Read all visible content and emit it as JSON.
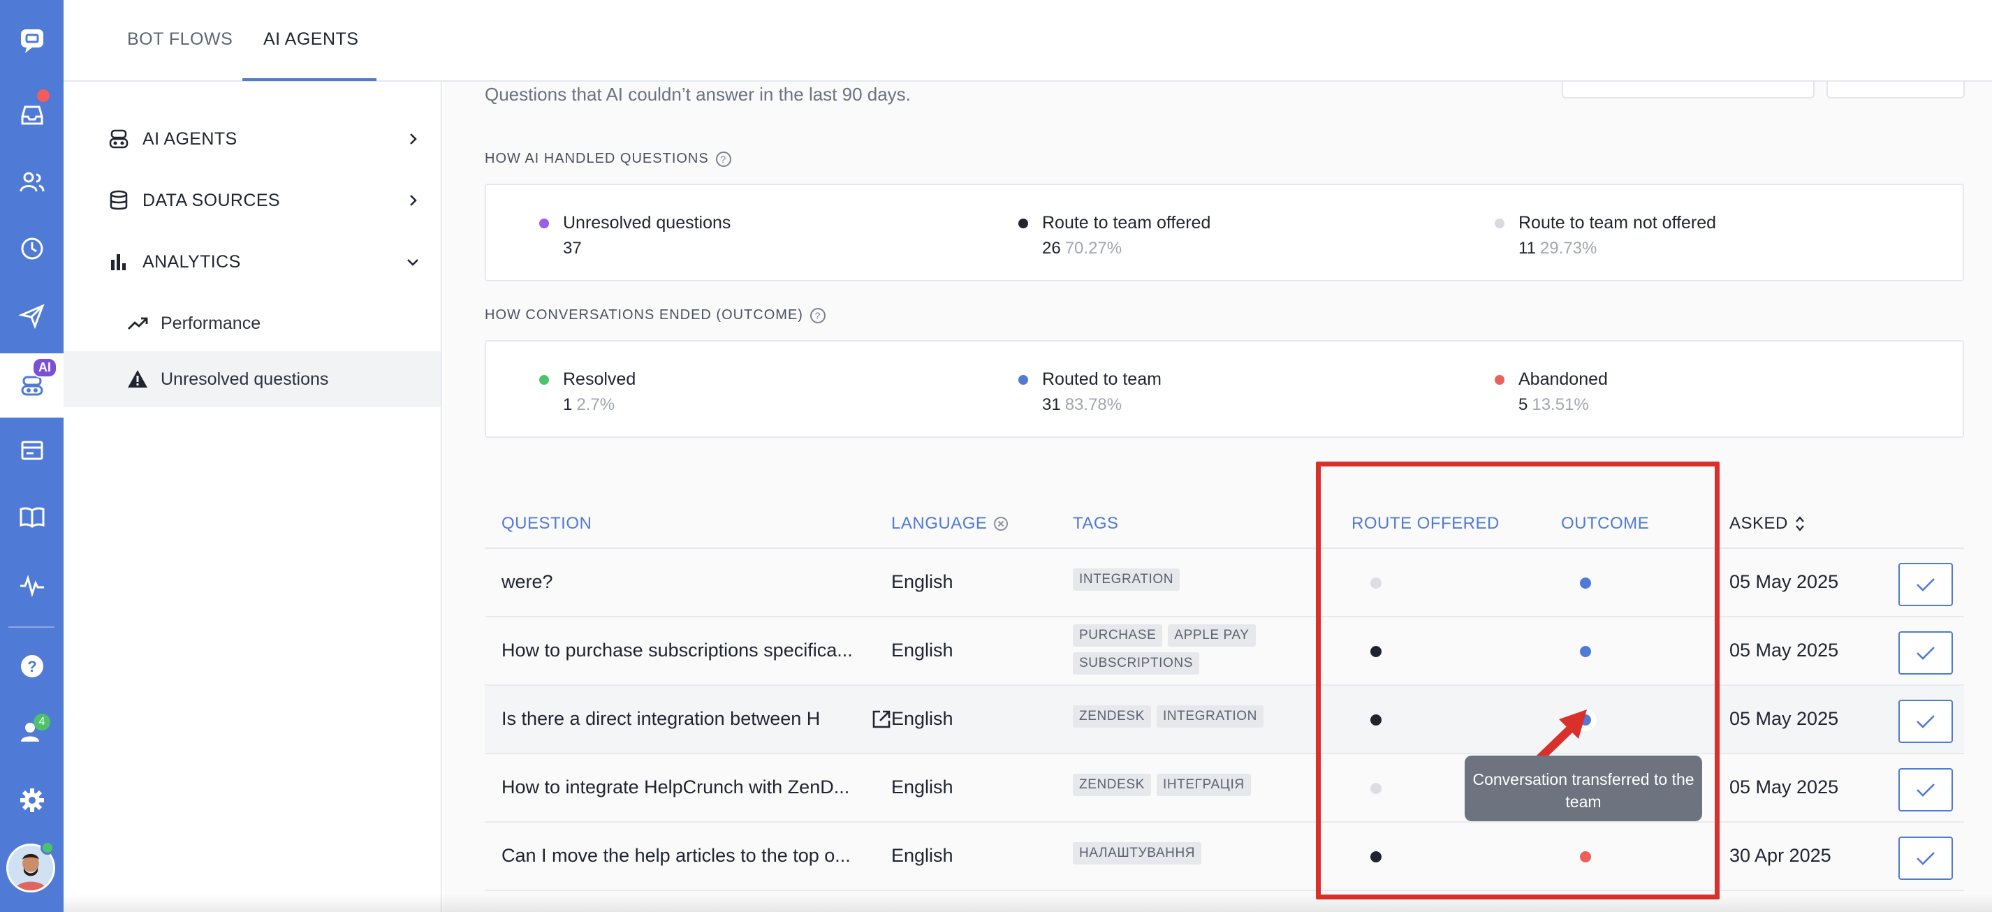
{
  "top_tabs": [
    {
      "label": "BOT FLOWS"
    },
    {
      "label": "AI AGENTS"
    }
  ],
  "sidebar": {
    "items": [
      {
        "label": "AI AGENTS",
        "icon": "robot-icon"
      },
      {
        "label": "DATA SOURCES",
        "icon": "database-icon"
      },
      {
        "label": "ANALYTICS",
        "icon": "bar-chart-icon"
      },
      {
        "label": "Performance",
        "icon": "trend-up-icon"
      },
      {
        "label": "Unresolved questions",
        "icon": "warning-icon"
      }
    ]
  },
  "rail": {
    "ai_badge": "AI",
    "team_badge": "4"
  },
  "main": {
    "subtitle": "Questions that AI couldn’t answer in the last 90 days.",
    "handled": {
      "label": "HOW AI HANDLED QUESTIONS",
      "stats": [
        {
          "name": "Unresolved questions",
          "value": "37",
          "pct": "",
          "color": "#9b5de5"
        },
        {
          "name": "Route to team offered",
          "value": "26",
          "pct": "70.27%",
          "color": "#1f2430"
        },
        {
          "name": "Route to team not offered",
          "value": "11",
          "pct": "29.73%",
          "color": "#d8dadf"
        }
      ]
    },
    "outcome": {
      "label": "HOW CONVERSATIONS ENDED (OUTCOME)",
      "stats": [
        {
          "name": "Resolved",
          "value": "1",
          "pct": "2.7%",
          "color": "#4cc36a"
        },
        {
          "name": "Routed to team",
          "value": "31",
          "pct": "83.78%",
          "color": "#4f7ad6"
        },
        {
          "name": "Abandoned",
          "value": "5",
          "pct": "13.51%",
          "color": "#e8615a"
        }
      ]
    },
    "table": {
      "headers": {
        "question": "QUESTION",
        "language": "LANGUAGE",
        "tags": "TAGS",
        "route_offered": "ROUTE OFFERED",
        "outcome": "OUTCOME",
        "asked": "ASKED"
      },
      "rows": [
        {
          "question": "were?",
          "language": "English",
          "tags": [
            "INTEGRATION"
          ],
          "route": "#dcdee2",
          "outcome": "#4f7ad6",
          "asked": "05 May 2025"
        },
        {
          "question": "How to purchase subscriptions specifica...",
          "language": "English",
          "tags": [
            "PURCHASE",
            "APPLE PAY",
            "SUBSCRIPTIONS"
          ],
          "route": "#1f2430",
          "outcome": "#4f7ad6",
          "asked": "05 May 2025"
        },
        {
          "question": "Is there a direct integration between H",
          "language": "English",
          "tags": [
            "ZENDESK",
            "INTEGRATION"
          ],
          "route": "#1f2430",
          "outcome": "#4f7ad6",
          "asked": "05 May 2025"
        },
        {
          "question": "How to integrate HelpCrunch with ZenD...",
          "language": "English",
          "tags": [
            "ZENDESK",
            "ІНТЕГРАЦІЯ"
          ],
          "route": "#dcdee2",
          "outcome": "#4f7ad6",
          "asked": "05 May 2025"
        },
        {
          "question": "Can I move the help articles to the top o...",
          "language": "English",
          "tags": [
            "НАЛАШТУВАННЯ"
          ],
          "route": "#1f2430",
          "outcome": "#e8615a",
          "asked": "30 Apr 2025"
        }
      ]
    },
    "tooltip": "Conversation transferred to the team"
  }
}
